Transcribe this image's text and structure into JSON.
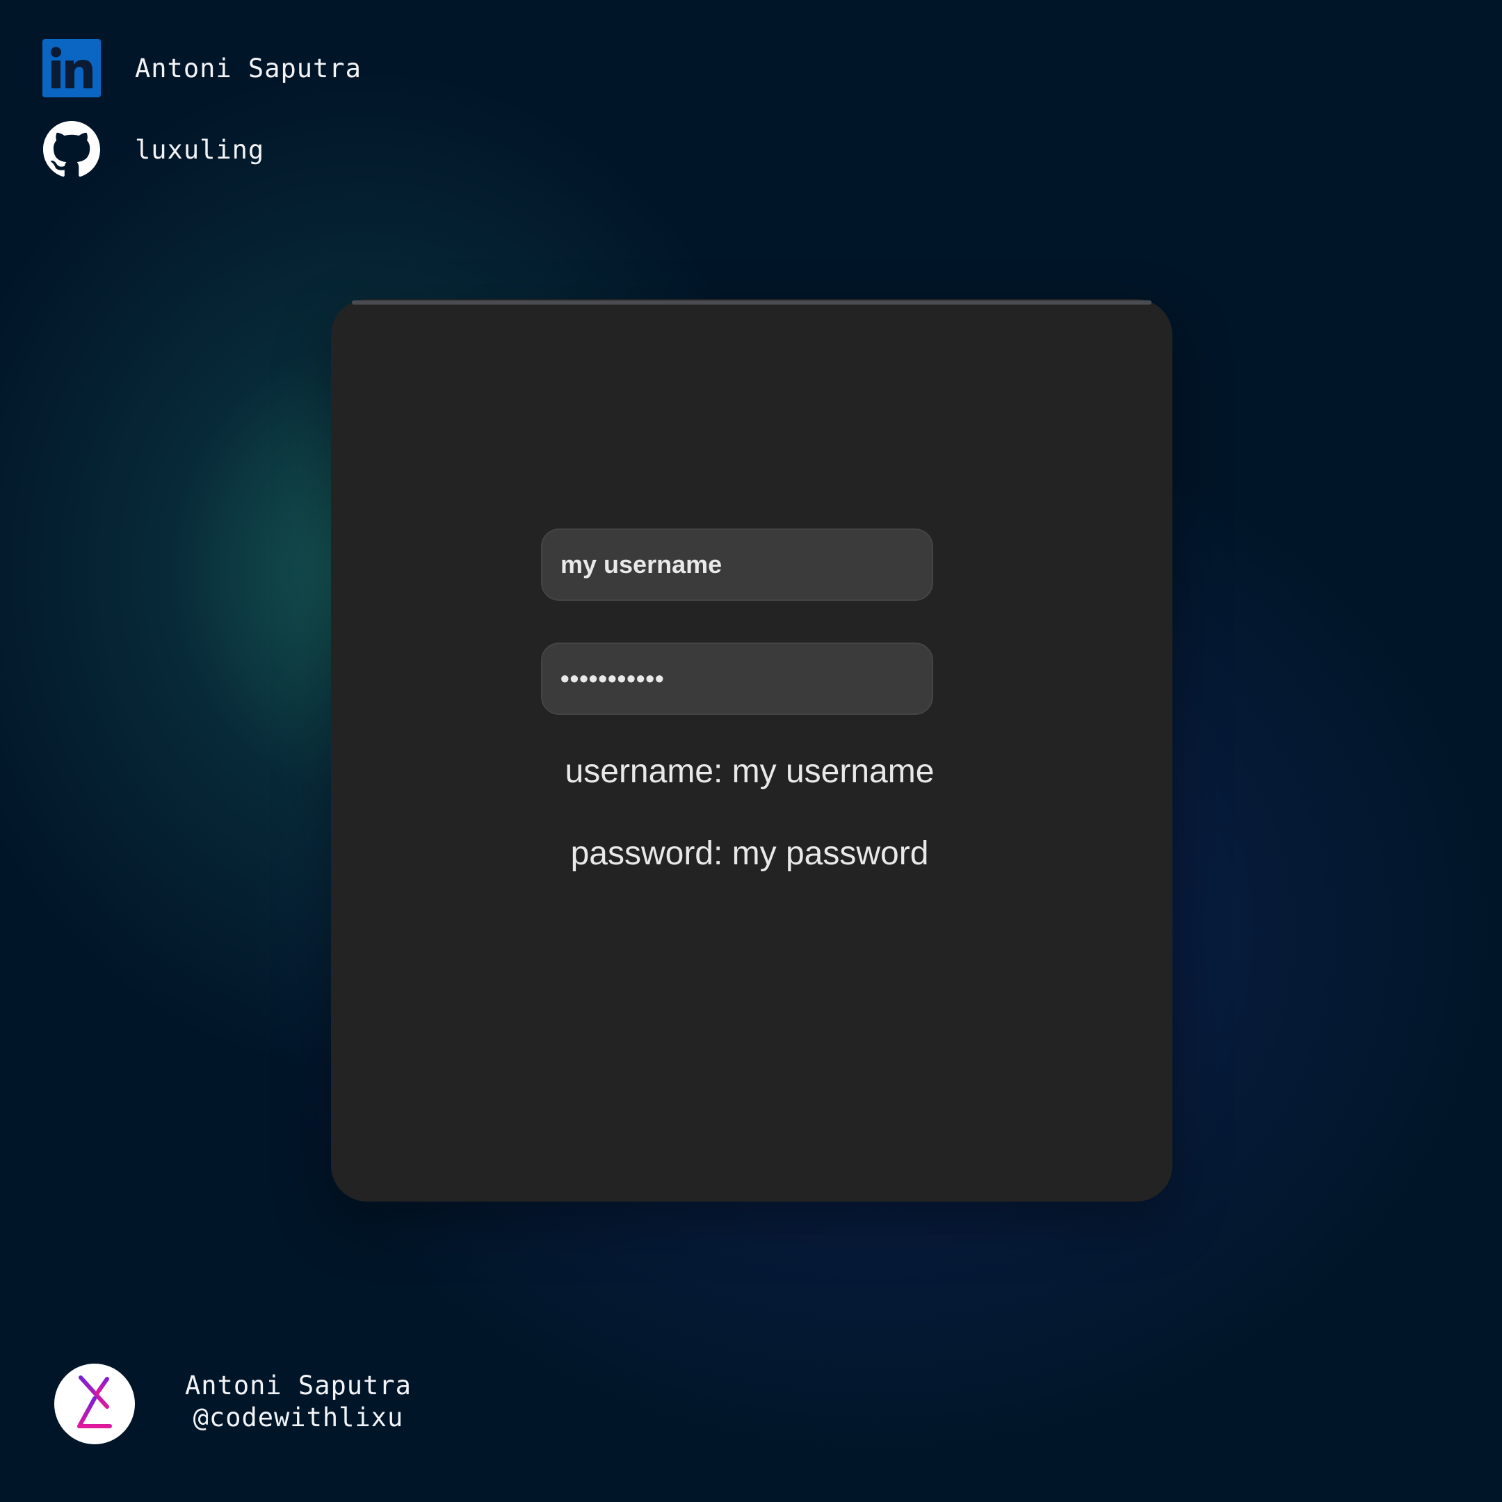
{
  "social": {
    "linkedin": {
      "icon": "linkedin-icon",
      "label": "Antoni Saputra"
    },
    "github": {
      "icon": "github-icon",
      "label": "luxuling"
    }
  },
  "form": {
    "username_value": "my username",
    "password_value": "•••••••••••",
    "username_output": "username: my username",
    "password_output": "password: my password"
  },
  "footer": {
    "logo_icon": "lx-logo-icon",
    "name": "Antoni Saputra",
    "handle": "@codewithlixu"
  },
  "colors": {
    "background": "#011528",
    "card": "#232323",
    "input": "#3b3b3b",
    "linkedin_blue": "#0a66c2",
    "logo_purple": "#7b1fd6",
    "logo_magenta": "#e0189a"
  }
}
